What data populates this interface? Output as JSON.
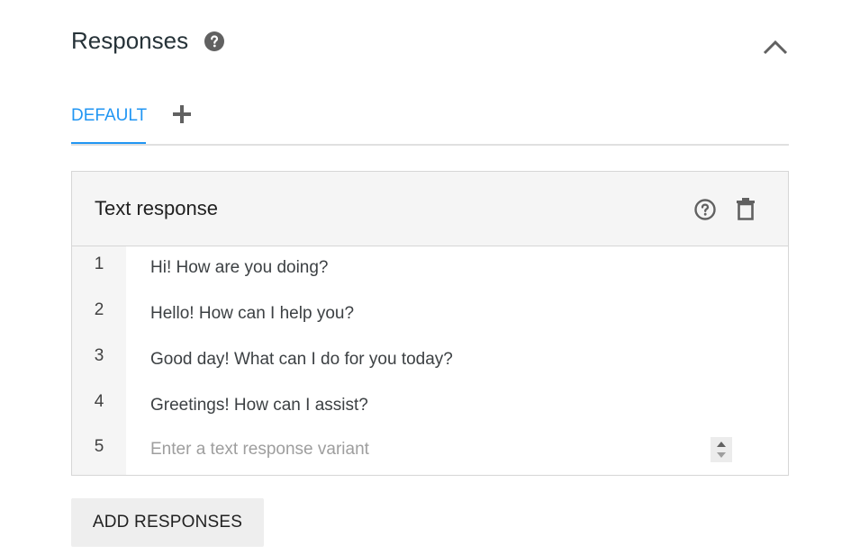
{
  "section": {
    "title": "Responses",
    "help_icon": "help-circle-filled-icon",
    "collapse_icon": "chevron-up-icon"
  },
  "tabs": {
    "items": [
      {
        "label": "DEFAULT",
        "active": true
      }
    ],
    "add_icon": "plus-icon",
    "active_color": "#2196f3"
  },
  "text_response_card": {
    "title": "Text response",
    "help_icon": "help-circle-outline-icon",
    "delete_icon": "trash-icon",
    "rows": [
      {
        "number": "1",
        "text": "Hi! How are you doing?"
      },
      {
        "number": "2",
        "text": "Hello! How can I help you?"
      },
      {
        "number": "3",
        "text": "Good day! What can I do for you today?"
      },
      {
        "number": "4",
        "text": "Greetings! How can I assist?"
      }
    ],
    "new_row": {
      "number": "5",
      "value": "",
      "placeholder": "Enter a text response variant"
    }
  },
  "actions": {
    "add_responses_label": "ADD RESPONSES"
  }
}
